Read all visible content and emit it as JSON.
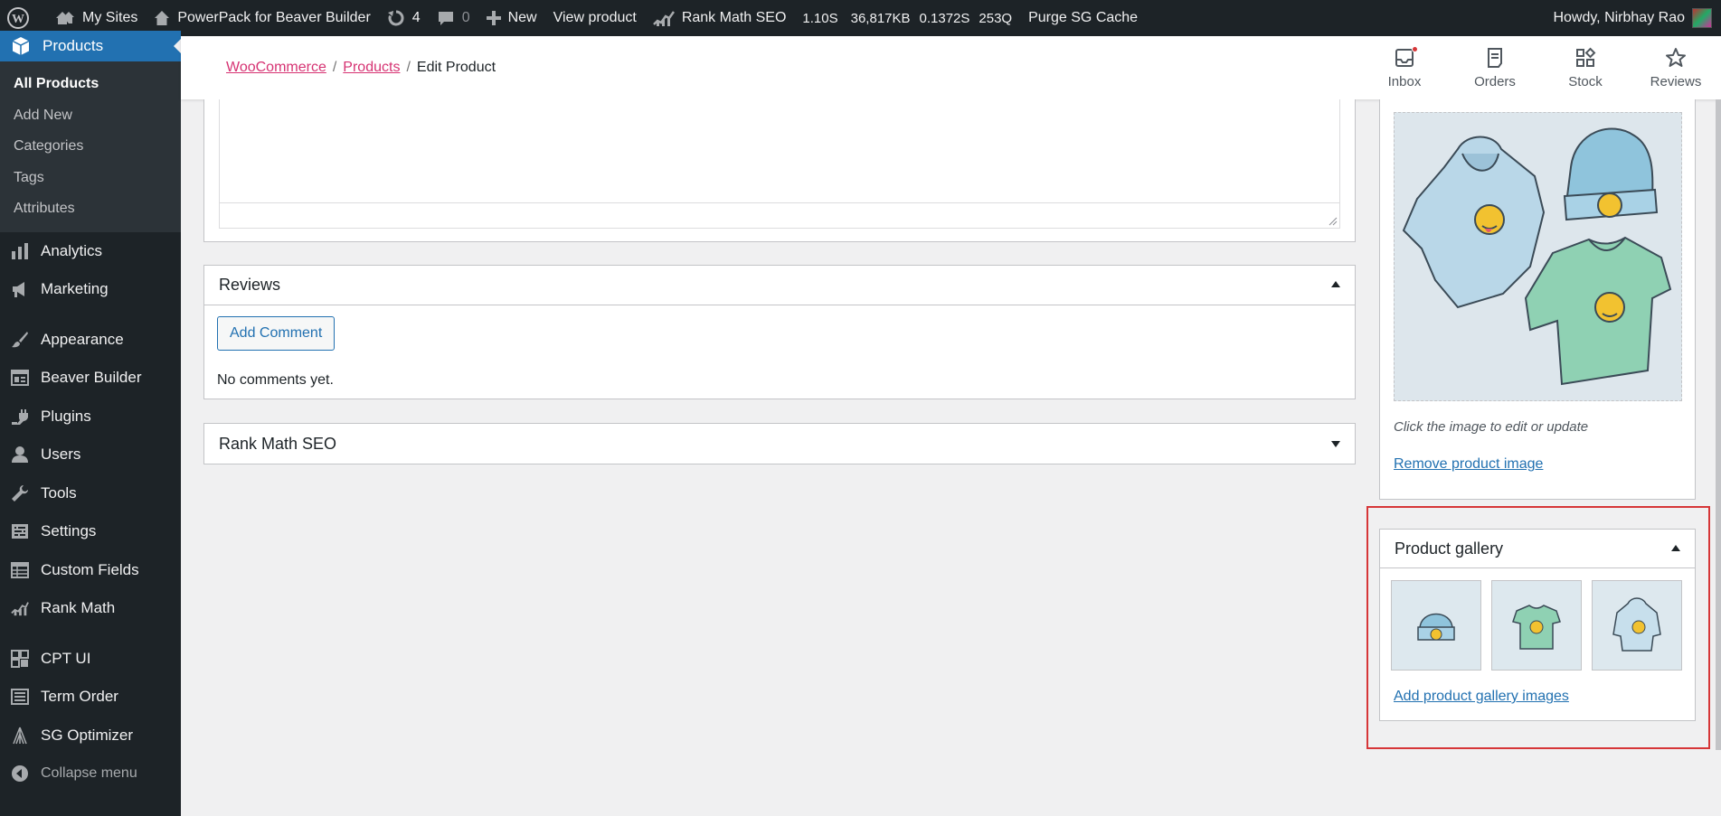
{
  "admin_bar": {
    "my_sites": "My Sites",
    "site_name": "PowerPack for Beaver Builder",
    "updates_count": "4",
    "comments_count": "0",
    "new_label": "New",
    "view_product": "View product",
    "rank_math": "Rank Math SEO",
    "query_monitor": [
      "1.10S",
      "36,817KB",
      "0.1372S",
      "253Q"
    ],
    "purge_cache": "Purge SG Cache",
    "howdy": "Howdy, Nirbhay Rao"
  },
  "sidebar": {
    "current_menu": "Products",
    "submenu": [
      "All Products",
      "Add New",
      "Categories",
      "Tags",
      "Attributes"
    ],
    "items": [
      {
        "label": "Analytics",
        "icon": "bar-chart-icon"
      },
      {
        "label": "Marketing",
        "icon": "megaphone-icon"
      },
      {
        "label": "Appearance",
        "icon": "paintbrush-icon"
      },
      {
        "label": "Beaver Builder",
        "icon": "grid-layout-icon"
      },
      {
        "label": "Plugins",
        "icon": "plug-icon"
      },
      {
        "label": "Users",
        "icon": "user-icon"
      },
      {
        "label": "Tools",
        "icon": "wrench-icon"
      },
      {
        "label": "Settings",
        "icon": "sliders-icon"
      },
      {
        "label": "Custom Fields",
        "icon": "table-icon"
      },
      {
        "label": "Rank Math",
        "icon": "rank-chart-icon"
      },
      {
        "label": "CPT UI",
        "icon": "cpt-icon"
      },
      {
        "label": "Term Order",
        "icon": "list-icon"
      },
      {
        "label": "SG Optimizer",
        "icon": "sg-icon"
      }
    ],
    "collapse": "Collapse menu"
  },
  "header": {
    "breadcrumb": [
      "WooCommerce",
      "Products",
      "Edit Product"
    ],
    "activity": [
      "Inbox",
      "Orders",
      "Stock",
      "Reviews"
    ]
  },
  "reviews": {
    "title": "Reviews",
    "add_comment": "Add Comment",
    "empty": "No comments yet."
  },
  "rank_math_box": {
    "title": "Rank Math SEO"
  },
  "product_image": {
    "hint": "Click the image to edit or update",
    "remove": "Remove product image"
  },
  "gallery": {
    "title": "Product gallery",
    "thumbs": [
      "beanie-thumbnail",
      "tshirt-thumbnail",
      "hoodie-thumbnail"
    ],
    "add": "Add product gallery images"
  },
  "colors": {
    "admin_bar": "#1d2327",
    "accent": "#2271b1",
    "link_pink": "#d63373",
    "highlight": "#d63638"
  }
}
